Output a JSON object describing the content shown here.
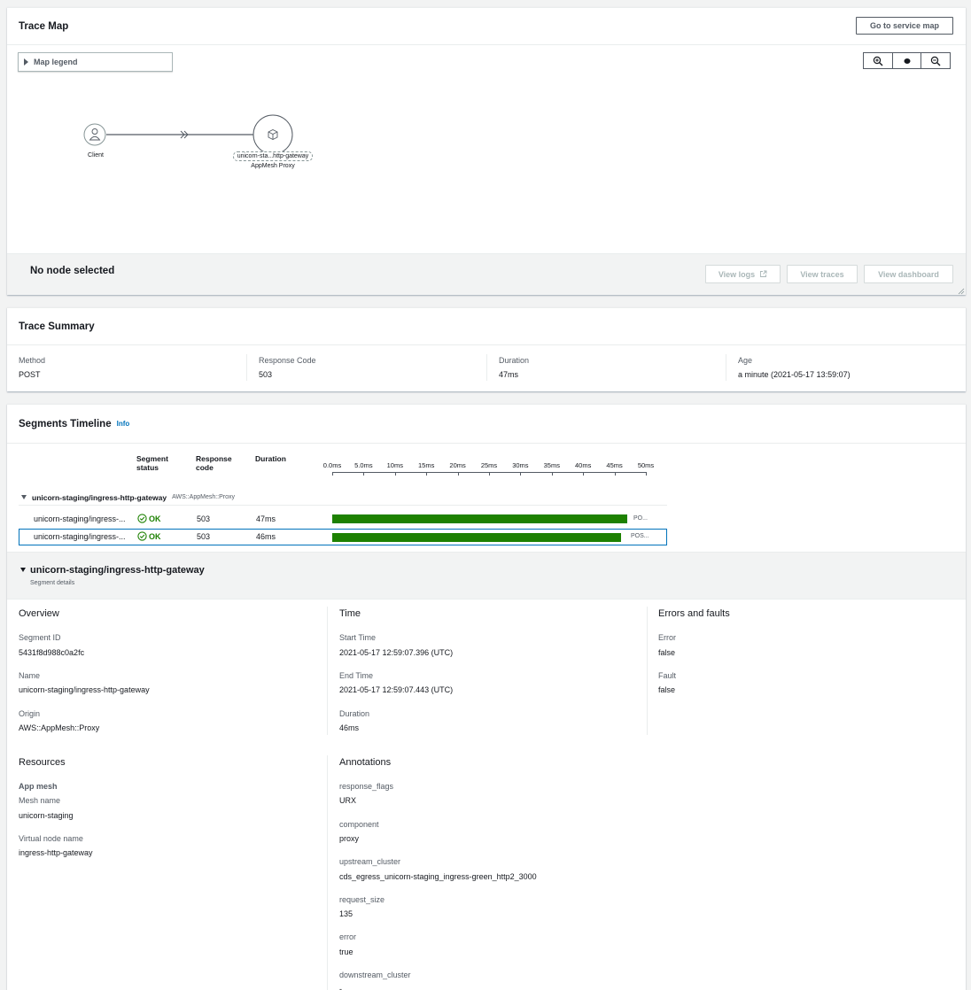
{
  "trace_map": {
    "title": "Trace Map",
    "go_service_map": "Go to service map",
    "map_legend": "Map legend",
    "client_label": "Client",
    "proxy_name": "unicorn-sta...http-gateway",
    "proxy_type": "AppMesh Proxy",
    "no_node": "No node selected",
    "view_logs": "View logs",
    "view_traces": "View traces",
    "view_dashboard": "View dashboard"
  },
  "trace_summary": {
    "title": "Trace Summary",
    "fields": [
      {
        "label": "Method",
        "value": "POST"
      },
      {
        "label": "Response Code",
        "value": "503"
      },
      {
        "label": "Duration",
        "value": "47ms"
      },
      {
        "label": "Age",
        "value": "a minute (2021-05-17 13:59:07)"
      }
    ]
  },
  "segments": {
    "title": "Segments Timeline",
    "info": "Info",
    "col_status_1": "Segment",
    "col_status_2": "status",
    "col_code_1": "Response",
    "col_code_2": "code",
    "col_duration": "Duration",
    "ticks": [
      "0.0ms",
      "5.0ms",
      "10ms",
      "15ms",
      "20ms",
      "25ms",
      "30ms",
      "35ms",
      "40ms",
      "45ms",
      "50ms"
    ],
    "group_name": "unicorn-staging/ingress-http-gateway",
    "group_type": "AWS::AppMesh::Proxy",
    "rows": [
      {
        "name": "unicorn-staging/ingress-...",
        "status": "OK",
        "code": "503",
        "duration": "47ms",
        "bar_label": "PO...",
        "start_ms": 0,
        "dur_ms": 47
      },
      {
        "name": "unicorn-staging/ingress-...",
        "status": "OK",
        "code": "503",
        "duration": "46ms",
        "bar_label": "POS...",
        "start_ms": 0,
        "dur_ms": 46
      }
    ]
  },
  "details": {
    "title": "unicorn-staging/ingress-http-gateway",
    "subtitle": "Segment details",
    "overview": {
      "heading": "Overview",
      "segment_id_label": "Segment ID",
      "segment_id": "5431f8d988c0a2fc",
      "name_label": "Name",
      "name": "unicorn-staging/ingress-http-gateway",
      "origin_label": "Origin",
      "origin": "AWS::AppMesh::Proxy"
    },
    "time": {
      "heading": "Time",
      "start_label": "Start Time",
      "start": "2021-05-17 12:59:07.396 (UTC)",
      "end_label": "End Time",
      "end": "2021-05-17 12:59:07.443 (UTC)",
      "duration_label": "Duration",
      "duration": "46ms"
    },
    "errors": {
      "heading": "Errors and faults",
      "error_label": "Error",
      "error": "false",
      "fault_label": "Fault",
      "fault": "false"
    },
    "resources": {
      "heading": "Resources",
      "app_mesh": "App mesh",
      "mesh_name_label": "Mesh name",
      "mesh_name": "unicorn-staging",
      "vnode_label": "Virtual node name",
      "vnode": "ingress-http-gateway"
    },
    "annotations": {
      "heading": "Annotations",
      "items": [
        {
          "key": "response_flags",
          "value": "URX"
        },
        {
          "key": "component",
          "value": "proxy"
        },
        {
          "key": "upstream_cluster",
          "value": "cds_egress_unicorn-staging_ingress-green_http2_3000"
        },
        {
          "key": "request_size",
          "value": "135"
        },
        {
          "key": "error",
          "value": "true"
        },
        {
          "key": "downstream_cluster",
          "value": "-"
        }
      ]
    }
  }
}
